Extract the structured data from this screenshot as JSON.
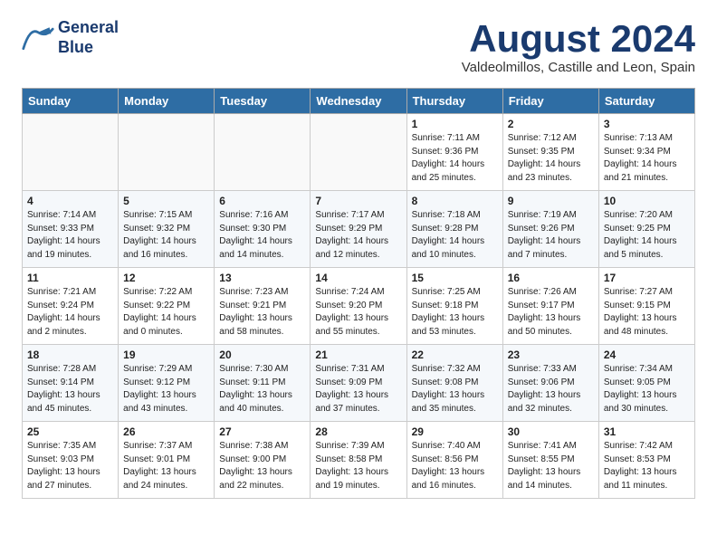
{
  "header": {
    "logo_line1": "General",
    "logo_line2": "Blue",
    "month_year": "August 2024",
    "location": "Valdeolmillos, Castille and Leon, Spain"
  },
  "days_of_week": [
    "Sunday",
    "Monday",
    "Tuesday",
    "Wednesday",
    "Thursday",
    "Friday",
    "Saturday"
  ],
  "weeks": [
    [
      {
        "day": "",
        "info": ""
      },
      {
        "day": "",
        "info": ""
      },
      {
        "day": "",
        "info": ""
      },
      {
        "day": "",
        "info": ""
      },
      {
        "day": "1",
        "info": "Sunrise: 7:11 AM\nSunset: 9:36 PM\nDaylight: 14 hours\nand 25 minutes."
      },
      {
        "day": "2",
        "info": "Sunrise: 7:12 AM\nSunset: 9:35 PM\nDaylight: 14 hours\nand 23 minutes."
      },
      {
        "day": "3",
        "info": "Sunrise: 7:13 AM\nSunset: 9:34 PM\nDaylight: 14 hours\nand 21 minutes."
      }
    ],
    [
      {
        "day": "4",
        "info": "Sunrise: 7:14 AM\nSunset: 9:33 PM\nDaylight: 14 hours\nand 19 minutes."
      },
      {
        "day": "5",
        "info": "Sunrise: 7:15 AM\nSunset: 9:32 PM\nDaylight: 14 hours\nand 16 minutes."
      },
      {
        "day": "6",
        "info": "Sunrise: 7:16 AM\nSunset: 9:30 PM\nDaylight: 14 hours\nand 14 minutes."
      },
      {
        "day": "7",
        "info": "Sunrise: 7:17 AM\nSunset: 9:29 PM\nDaylight: 14 hours\nand 12 minutes."
      },
      {
        "day": "8",
        "info": "Sunrise: 7:18 AM\nSunset: 9:28 PM\nDaylight: 14 hours\nand 10 minutes."
      },
      {
        "day": "9",
        "info": "Sunrise: 7:19 AM\nSunset: 9:26 PM\nDaylight: 14 hours\nand 7 minutes."
      },
      {
        "day": "10",
        "info": "Sunrise: 7:20 AM\nSunset: 9:25 PM\nDaylight: 14 hours\nand 5 minutes."
      }
    ],
    [
      {
        "day": "11",
        "info": "Sunrise: 7:21 AM\nSunset: 9:24 PM\nDaylight: 14 hours\nand 2 minutes."
      },
      {
        "day": "12",
        "info": "Sunrise: 7:22 AM\nSunset: 9:22 PM\nDaylight: 14 hours\nand 0 minutes."
      },
      {
        "day": "13",
        "info": "Sunrise: 7:23 AM\nSunset: 9:21 PM\nDaylight: 13 hours\nand 58 minutes."
      },
      {
        "day": "14",
        "info": "Sunrise: 7:24 AM\nSunset: 9:20 PM\nDaylight: 13 hours\nand 55 minutes."
      },
      {
        "day": "15",
        "info": "Sunrise: 7:25 AM\nSunset: 9:18 PM\nDaylight: 13 hours\nand 53 minutes."
      },
      {
        "day": "16",
        "info": "Sunrise: 7:26 AM\nSunset: 9:17 PM\nDaylight: 13 hours\nand 50 minutes."
      },
      {
        "day": "17",
        "info": "Sunrise: 7:27 AM\nSunset: 9:15 PM\nDaylight: 13 hours\nand 48 minutes."
      }
    ],
    [
      {
        "day": "18",
        "info": "Sunrise: 7:28 AM\nSunset: 9:14 PM\nDaylight: 13 hours\nand 45 minutes."
      },
      {
        "day": "19",
        "info": "Sunrise: 7:29 AM\nSunset: 9:12 PM\nDaylight: 13 hours\nand 43 minutes."
      },
      {
        "day": "20",
        "info": "Sunrise: 7:30 AM\nSunset: 9:11 PM\nDaylight: 13 hours\nand 40 minutes."
      },
      {
        "day": "21",
        "info": "Sunrise: 7:31 AM\nSunset: 9:09 PM\nDaylight: 13 hours\nand 37 minutes."
      },
      {
        "day": "22",
        "info": "Sunrise: 7:32 AM\nSunset: 9:08 PM\nDaylight: 13 hours\nand 35 minutes."
      },
      {
        "day": "23",
        "info": "Sunrise: 7:33 AM\nSunset: 9:06 PM\nDaylight: 13 hours\nand 32 minutes."
      },
      {
        "day": "24",
        "info": "Sunrise: 7:34 AM\nSunset: 9:05 PM\nDaylight: 13 hours\nand 30 minutes."
      }
    ],
    [
      {
        "day": "25",
        "info": "Sunrise: 7:35 AM\nSunset: 9:03 PM\nDaylight: 13 hours\nand 27 minutes."
      },
      {
        "day": "26",
        "info": "Sunrise: 7:37 AM\nSunset: 9:01 PM\nDaylight: 13 hours\nand 24 minutes."
      },
      {
        "day": "27",
        "info": "Sunrise: 7:38 AM\nSunset: 9:00 PM\nDaylight: 13 hours\nand 22 minutes."
      },
      {
        "day": "28",
        "info": "Sunrise: 7:39 AM\nSunset: 8:58 PM\nDaylight: 13 hours\nand 19 minutes."
      },
      {
        "day": "29",
        "info": "Sunrise: 7:40 AM\nSunset: 8:56 PM\nDaylight: 13 hours\nand 16 minutes."
      },
      {
        "day": "30",
        "info": "Sunrise: 7:41 AM\nSunset: 8:55 PM\nDaylight: 13 hours\nand 14 minutes."
      },
      {
        "day": "31",
        "info": "Sunrise: 7:42 AM\nSunset: 8:53 PM\nDaylight: 13 hours\nand 11 minutes."
      }
    ]
  ]
}
